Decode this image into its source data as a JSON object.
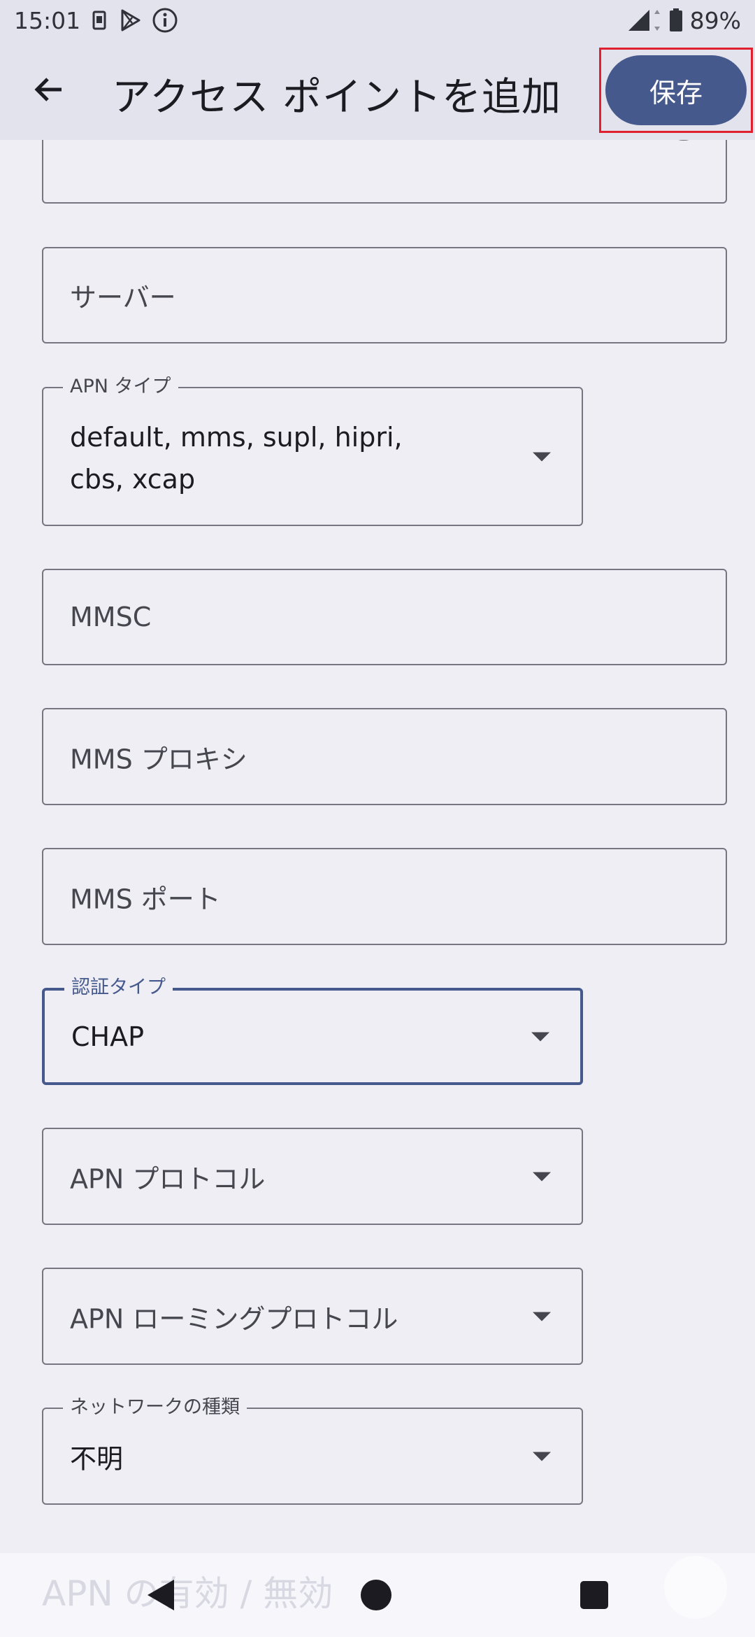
{
  "status_bar": {
    "time": "15:01",
    "battery": "89%",
    "icons": [
      "sim-icon",
      "play-store-icon",
      "info-icon",
      "signal-icon",
      "battery-icon"
    ]
  },
  "app_bar": {
    "title": "アクセス ポイントを追加",
    "save_label": "保存"
  },
  "form": {
    "password": {
      "value": "••••"
    },
    "server": {
      "placeholder": "サーバー"
    },
    "apn_type": {
      "label": "APN タイプ",
      "value": "default, mms, supl, hipri, cbs, xcap"
    },
    "mmsc": {
      "placeholder": "MMSC"
    },
    "mms_proxy": {
      "placeholder": "MMS プロキシ"
    },
    "mms_port": {
      "placeholder": "MMS ポート"
    },
    "auth_type": {
      "label": "認証タイプ",
      "value": "CHAP"
    },
    "apn_protocol": {
      "placeholder": "APN プロトコル"
    },
    "apn_roaming_protocol": {
      "placeholder": "APN ローミングプロトコル"
    },
    "network_type": {
      "label": "ネットワークの種類",
      "value": "不明"
    },
    "apn_enable_label": "APN の有効 / 無効"
  },
  "colors": {
    "accent": "#45598c",
    "highlight_box": "#e0202e",
    "background": "#efeef5",
    "app_bar": "#e2e3ec"
  }
}
